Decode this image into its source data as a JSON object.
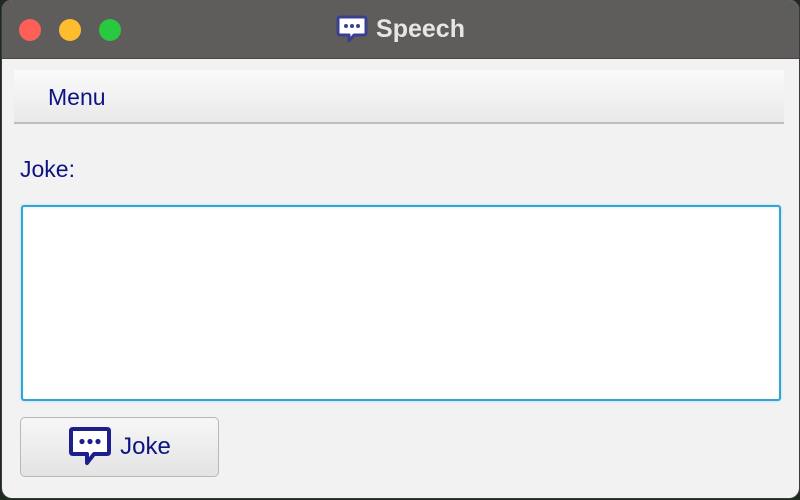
{
  "window": {
    "title": "Speech"
  },
  "menubar": {
    "menu_label": "Menu"
  },
  "form": {
    "joke_label": "Joke:",
    "joke_text": ""
  },
  "actions": {
    "joke_button_label": "Joke"
  },
  "icons": {
    "title_icon": "speech-bubble-icon",
    "button_icon": "speech-bubble-icon"
  },
  "colors": {
    "text_accent": "#0d1480",
    "focus_border": "#2fa5d7",
    "icon_color": "#1c1f8c",
    "close": "#fe5f57",
    "minimize": "#febc2e",
    "maximize": "#28c840"
  }
}
